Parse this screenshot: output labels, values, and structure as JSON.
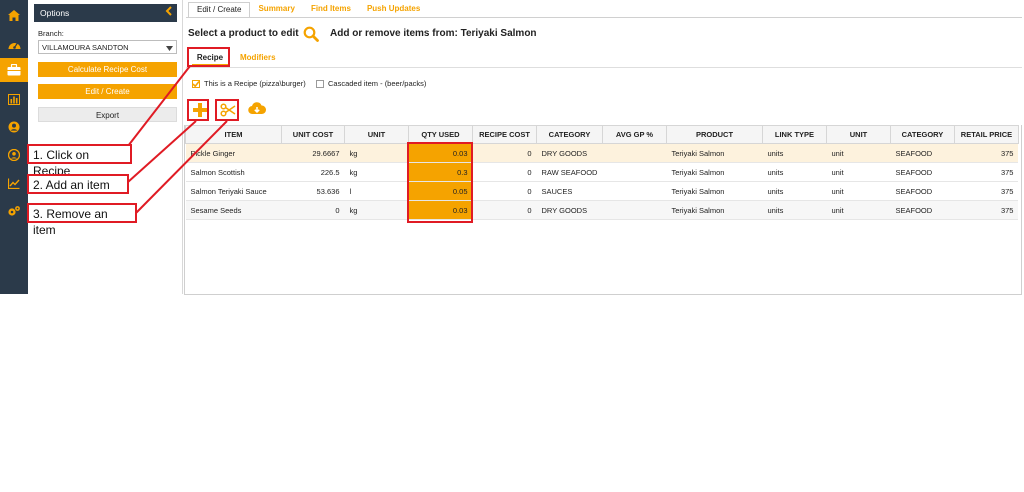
{
  "sidebar": {
    "icons": [
      "home-icon",
      "dashboard-icon",
      "briefcase-icon",
      "bar-chart-icon",
      "user-circle-icon",
      "account-icon",
      "trend-chart-icon",
      "settings-icon"
    ],
    "active_index": 2
  },
  "options": {
    "title": "Options",
    "branch_label": "Branch:",
    "branch_value": "VILLAMOURA SANDTON",
    "calc_button": "Calculate Recipe Cost",
    "edit_button": "Edit / Create",
    "export_button": "Export"
  },
  "tabs": [
    "Edit / Create",
    "Summary",
    "Find Items",
    "Push Updates"
  ],
  "main": {
    "select_title": "Select a product to edit",
    "add_remove_title": "Add or remove items from: Teriyaki Salmon"
  },
  "subtabs": {
    "recipe": "Recipe",
    "modifiers": "Modifiers"
  },
  "checks": {
    "is_recipe": "This is a Recipe (pizza\\burger)",
    "cascaded": "Cascaded item - (beer/packs)"
  },
  "table": {
    "headers": [
      "ITEM",
      "UNIT COST",
      "UNIT",
      "QTY USED",
      "RECIPE COST",
      "CATEGORY",
      "AVG GP %",
      "PRODUCT",
      "LINK TYPE",
      "UNIT",
      "CATEGORY",
      "RETAIL PRICE"
    ],
    "rows": [
      [
        "Pickle Ginger",
        "29.6667",
        "kg",
        "0.03",
        "0",
        "DRY GOODS",
        "",
        "Teriyaki Salmon",
        "units",
        "unit",
        "SEAFOOD",
        "375"
      ],
      [
        "Salmon Scottish",
        "226.5",
        "kg",
        "0.3",
        "0",
        "RAW SEAFOOD",
        "",
        "Teriyaki Salmon",
        "units",
        "unit",
        "SEAFOOD",
        "375"
      ],
      [
        "Salmon Teriyaki Sauce",
        "53.636",
        "l",
        "0.05",
        "0",
        "SAUCES",
        "",
        "Teriyaki Salmon",
        "units",
        "unit",
        "SEAFOOD",
        "375"
      ],
      [
        "Sesame Seeds",
        "0",
        "kg",
        "0.03",
        "0",
        "DRY GOODS",
        "",
        "Teriyaki Salmon",
        "units",
        "unit",
        "SEAFOOD",
        "375"
      ]
    ]
  },
  "annotations": [
    "1. Click on Recipe",
    "2. Add an item",
    "3. Remove an item"
  ],
  "colors": {
    "accent": "#f5a300",
    "rail": "#2b3a4a",
    "annotation": "#e01b24"
  }
}
